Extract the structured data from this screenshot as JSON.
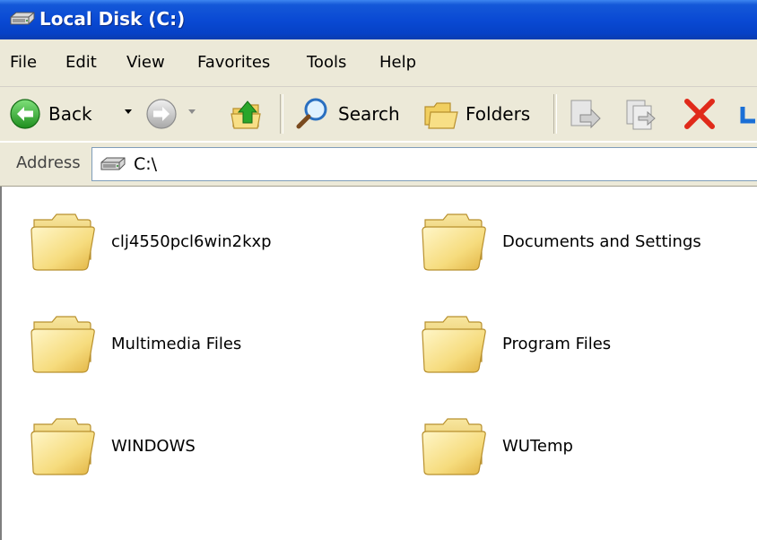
{
  "window": {
    "title": "Local Disk (C:)"
  },
  "menu": [
    "File",
    "Edit",
    "View",
    "Favorites",
    "Tools",
    "Help"
  ],
  "toolbar": {
    "back": "Back",
    "search": "Search",
    "folders": "Folders"
  },
  "address": {
    "label": "Address",
    "value": "C:\\"
  },
  "folders": [
    "clj4550pcl6win2kxp",
    "Documents and Settings",
    "Multimedia Files",
    "Program Files",
    "WINDOWS",
    "WUTemp"
  ],
  "colors": {
    "titlebar": "#0a4ad4",
    "chrome": "#ece9d8",
    "folder": "#f5d875"
  }
}
